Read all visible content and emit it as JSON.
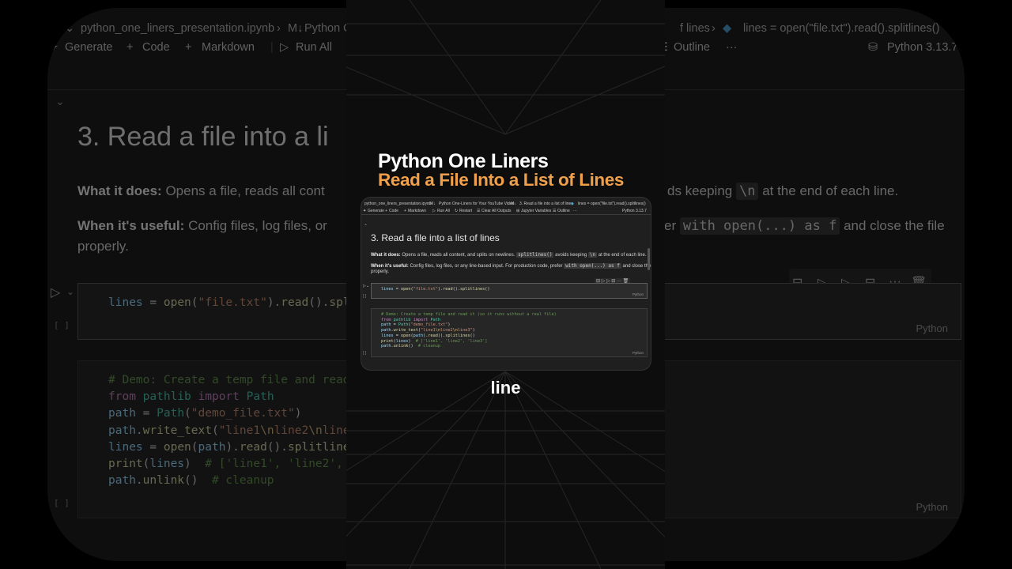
{
  "editor": {
    "breadcrumb": {
      "file": "python_one_liners_presentation.ipynb",
      "section": "Python One-Liners for Your YouTube Video",
      "heading": "3. Read a file into a list of lines",
      "cell": "lines = open(\"file.txt\").read().splitlines()",
      "bg_section_partial": "Python On",
      "bg_heading_partial": "f lines"
    },
    "toolbar": {
      "generate": "Generate",
      "code": "Code",
      "markdown": "Markdown",
      "run_all": "Run All",
      "restart": "Restart",
      "clear_outputs": "Clear All Outputs",
      "variables": "Jupyter Variables",
      "outline": "Outline",
      "more": "···",
      "kernel": "Python 3.13.7"
    },
    "heading": "3. Read a file into a list of lines",
    "heading_partial": "3. Read a file into a li",
    "what_label": "What it does:",
    "what_text_1": "Opens a file, reads all content, and splits on newlines.",
    "what_code_1": "splitlines()",
    "what_text_2": "avoids keeping",
    "what_code_2": "\\n",
    "what_text_3": "at the end of each line.",
    "what_bg_left": "Opens a file, reads all cont",
    "what_bg_right": "ds keeping",
    "useful_label": "When it's useful:",
    "useful_text_1": "Config files, log files, or any line-based input. For production code, prefer",
    "useful_code": "with open(...) as f",
    "useful_text_2": "and close the file properly.",
    "useful_text_2a": "and close the file",
    "useful_text_2b": "properly.",
    "useful_bg_left": "Config files, log files, or",
    "useful_bg_right": "er",
    "cell_lang": "Python",
    "exec_marker": "[ ]"
  },
  "overlay": {
    "title": "Python One Liners",
    "subtitle": "Read a File Into a List of Lines",
    "caption": "line"
  },
  "colors": {
    "subtitle": "#f0a04b",
    "background": "#000000",
    "editor_bg": "#1f1f1f"
  }
}
